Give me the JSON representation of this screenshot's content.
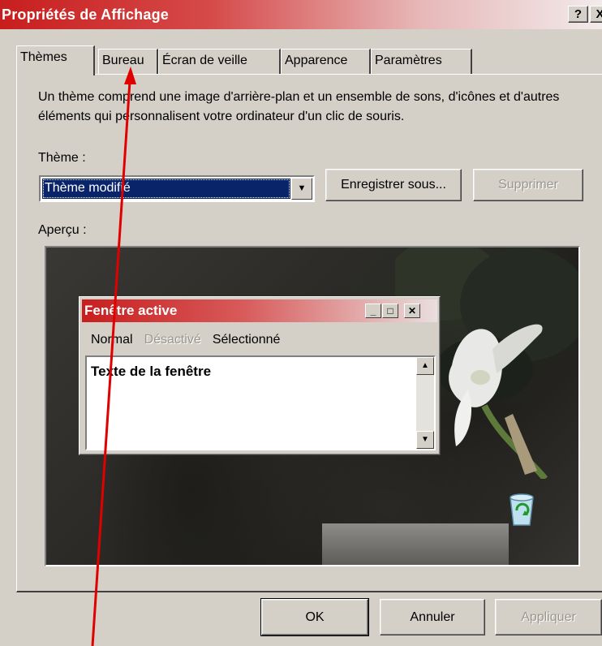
{
  "window": {
    "title": "Propriétés de Affichage",
    "help_button": "?",
    "close_button": "X"
  },
  "tabs": [
    {
      "label": "Thèmes",
      "active": true
    },
    {
      "label": "Bureau",
      "active": false
    },
    {
      "label": "Écran de veille",
      "active": false
    },
    {
      "label": "Apparence",
      "active": false
    },
    {
      "label": "Paramètres",
      "active": false
    }
  ],
  "themes_panel": {
    "description": "Un thème comprend une image d'arrière-plan et un ensemble de sons, d'icônes et d'autres éléments qui personnalisent votre ordinateur d'un clic de souris.",
    "theme_label": "Thème :",
    "theme_selected": "Thème modifié",
    "save_as_button": "Enregistrer sous...",
    "delete_button": "Supprimer",
    "preview_label": "Aperçu :"
  },
  "preview_window": {
    "title": "Fenêtre active",
    "menu": [
      "Normal",
      "Désactivé",
      "Sélectionné"
    ],
    "body_text": "Texte de la fenêtre"
  },
  "footer": {
    "ok": "OK",
    "cancel": "Annuler",
    "apply": "Appliquer"
  },
  "colors": {
    "title_bar": "#c81e1e",
    "dialog_face": "#d4d0c8",
    "selection": "#0a246a",
    "annotation_arrow": "#e00000"
  }
}
